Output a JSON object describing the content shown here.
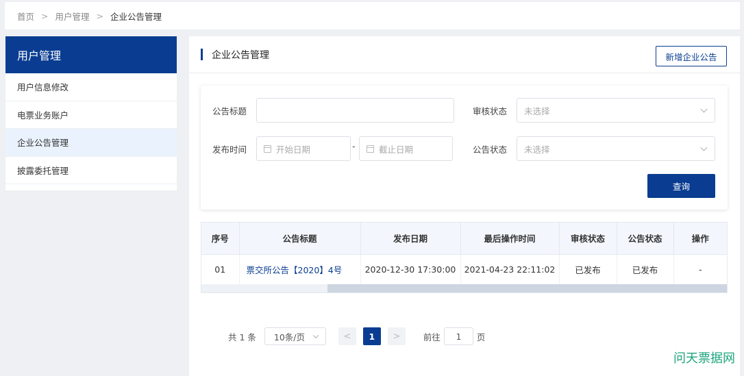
{
  "breadcrumb": {
    "items": [
      "首页",
      "用户管理",
      "企业公告管理"
    ],
    "separator": ">"
  },
  "sidebar": {
    "title": "用户管理",
    "items": [
      {
        "label": "用户信息修改"
      },
      {
        "label": "电票业务账户"
      },
      {
        "label": "企业公告管理"
      },
      {
        "label": "披露委托管理"
      }
    ]
  },
  "main": {
    "title": "企业公告管理",
    "new_button": "新增企业公告"
  },
  "filters": {
    "title_label": "公告标题",
    "title_value": "",
    "audit_label": "审核状态",
    "audit_placeholder": "未选择",
    "publish_time_label": "发布时间",
    "start_placeholder": "开始日期",
    "range_sep": "-",
    "end_placeholder": "截止日期",
    "notice_status_label": "公告状态",
    "notice_status_placeholder": "未选择",
    "query_button": "查询"
  },
  "table": {
    "headers": [
      "序号",
      "公告标题",
      "发布日期",
      "最后操作时间",
      "审核状态",
      "公告状态",
      "操作"
    ],
    "rows": [
      {
        "index": "01",
        "title": "票交所公告【2020】4号",
        "publish_date": "2020-12-30 17:30:00",
        "last_op_time": "2021-04-23 22:11:02",
        "audit_status": "已发布",
        "notice_status": "已发布",
        "action": "-"
      }
    ]
  },
  "pagination": {
    "total": "共 1 条",
    "page_size": "10条/页",
    "prev": "<",
    "current_page": "1",
    "next": ">",
    "goto_label": "前往",
    "goto_value": "1",
    "page_suffix": "页"
  },
  "watermark": "问天票据网",
  "colors": {
    "primary": "#0a3d91",
    "header_bg": "#f3f7fd",
    "active_item_bg": "#eaf2fd",
    "watermark": "#1ba57c"
  }
}
